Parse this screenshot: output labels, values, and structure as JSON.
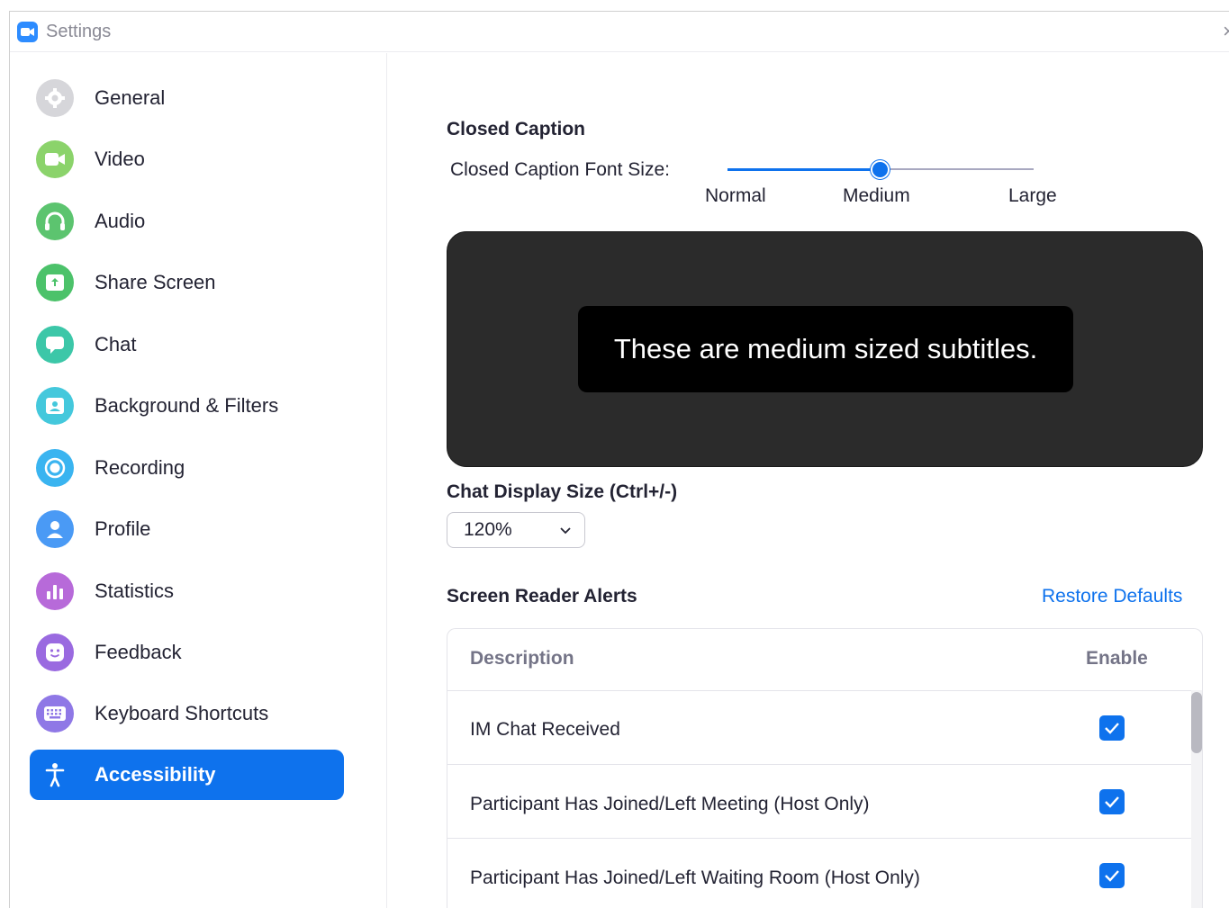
{
  "window": {
    "title": "Settings",
    "close_glyph": "×",
    "accent": "#0e72ed"
  },
  "sidebar": {
    "items": [
      {
        "label": "General",
        "icon": "gear-icon",
        "color": "#d6d6da"
      },
      {
        "label": "Video",
        "icon": "video-camera-icon",
        "color": "#8bd36b"
      },
      {
        "label": "Audio",
        "icon": "headphones-icon",
        "color": "#5cc46f"
      },
      {
        "label": "Share Screen",
        "icon": "share-screen-icon",
        "color": "#4cc26a"
      },
      {
        "label": "Chat",
        "icon": "chat-bubble-icon",
        "color": "#3cc7a8"
      },
      {
        "label": "Background & Filters",
        "icon": "background-portrait-icon",
        "color": "#44c8dc"
      },
      {
        "label": "Recording",
        "icon": "record-icon",
        "color": "#3ab4f0"
      },
      {
        "label": "Profile",
        "icon": "profile-icon",
        "color": "#4a9af5"
      },
      {
        "label": "Statistics",
        "icon": "statistics-bars-icon",
        "color": "#b76ad9"
      },
      {
        "label": "Feedback",
        "icon": "smiley-icon",
        "color": "#9a6ae0"
      },
      {
        "label": "Keyboard Shortcuts",
        "icon": "keyboard-icon",
        "color": "#8f78e6"
      },
      {
        "label": "Accessibility",
        "icon": "accessibility-icon",
        "active": true
      }
    ]
  },
  "closed_caption": {
    "heading": "Closed Caption",
    "font_size_label": "Closed Caption Font Size:",
    "options": [
      "Normal",
      "Medium",
      "Large"
    ],
    "selected": "Medium",
    "slider_fraction": 0.5,
    "preview_text": "These are medium sized subtitles."
  },
  "chat_display": {
    "heading": "Chat Display Size (Ctrl+/-)",
    "value": "120%"
  },
  "screen_reader": {
    "heading": "Screen Reader Alerts",
    "restore_label": "Restore Defaults",
    "columns": {
      "description": "Description",
      "enable": "Enable"
    },
    "rows": [
      {
        "label": "IM Chat Received",
        "enabled": true
      },
      {
        "label": "Participant Has Joined/Left Meeting (Host Only)",
        "enabled": true
      },
      {
        "label": "Participant Has Joined/Left Waiting Room (Host Only)",
        "enabled": true
      }
    ]
  }
}
